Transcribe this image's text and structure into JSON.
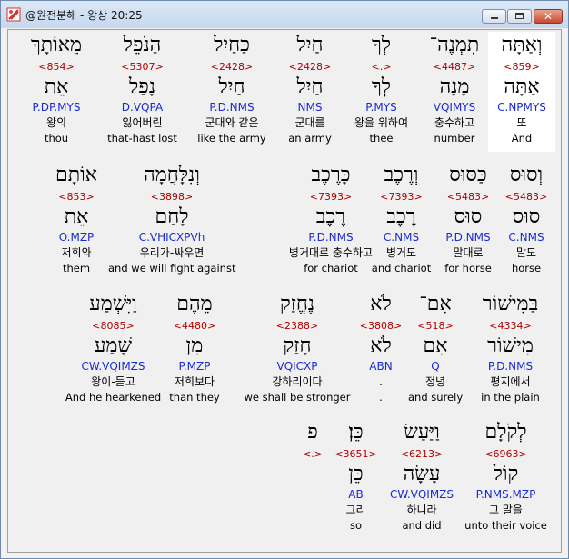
{
  "window": {
    "title": "@원전분해 - 왕상 20:25"
  },
  "verse": [
    {
      "id": "c1",
      "surface": "מֵאוֹתָךְ",
      "strongs": "<854>",
      "lemma": "אֵת",
      "parse": "P.DP.MYS",
      "korean": "왕의",
      "english": "thou"
    },
    {
      "id": "c2",
      "surface": "הַנֹּפֵל",
      "strongs": "<5307>",
      "lemma": "נָפַל",
      "parse": "D.VQPA",
      "korean": "잃어버린",
      "english": "that-hast lost"
    },
    {
      "id": "c3",
      "surface": "כַּחַיִל",
      "strongs": "<2428>",
      "lemma": "חַיִל",
      "parse": "P.D.NMS",
      "korean": "군대와 같은",
      "english": "like the army"
    },
    {
      "id": "c4",
      "surface": "חַיִל",
      "strongs": "<2428>",
      "lemma": "חַיִל",
      "parse": "NMS",
      "korean": "군대를",
      "english": "an army"
    },
    {
      "id": "c5",
      "surface": "לְךָ",
      "strongs": "<.>",
      "lemma": "לְךָ",
      "parse": "P.MYS",
      "korean": "왕을 위하여",
      "english": "thee"
    },
    {
      "id": "c6",
      "surface": "תִמְנֶה־",
      "strongs": "<4487>",
      "lemma": "מָנָה",
      "parse": "VQIMYS",
      "korean": "충수하고",
      "english": "number"
    },
    {
      "id": "c7",
      "surface": "וְאַתָּה",
      "strongs": "<859>",
      "lemma": "אַתָּה",
      "parse": "C.NPMYS",
      "korean": "또",
      "english": "And"
    },
    {
      "id": "c8",
      "surface": "אוֹתָם",
      "strongs": "<853>",
      "lemma": "אֵת",
      "parse": "O.MZP",
      "korean": "저희와",
      "english": "them"
    },
    {
      "id": "c9",
      "surface": "וְנִלָּחֲמָה",
      "strongs": "<3898>",
      "lemma": "לָחַם",
      "parse": "C.VHICXPVh",
      "korean": "우리가-싸우면",
      "english": "and we will fight against"
    },
    {
      "id": "c10",
      "surface": "כָּרֶכֶב",
      "strongs": "<7393>",
      "lemma": "רֶכֶב",
      "parse": "P.D.NMS",
      "korean": "병거대로 충수하고",
      "english": "for chariot"
    },
    {
      "id": "c11",
      "surface": "וְרֶכֶב",
      "strongs": "<7393>",
      "lemma": "רֶכֶב",
      "parse": "C.NMS",
      "korean": "병거도",
      "english": "and chariot"
    },
    {
      "id": "c12",
      "surface": "כַּסּוּס",
      "strongs": "<5483>",
      "lemma": "סוּס",
      "parse": "P.D.NMS",
      "korean": "말대로",
      "english": "for horse"
    },
    {
      "id": "c13",
      "surface": "וְסוּס",
      "strongs": "<5483>",
      "lemma": "סוּס",
      "parse": "C.NMS",
      "korean": "말도",
      "english": "horse"
    },
    {
      "id": "c14",
      "surface": "וַיִּשְׁמַע",
      "strongs": "<8085>",
      "lemma": "שָׁמַע",
      "parse": "CW.VQIMZS",
      "korean": "왕이-듣고",
      "english": "And he hearkened"
    },
    {
      "id": "c15",
      "surface": "מֵהֶם",
      "strongs": "<4480>",
      "lemma": "מִן",
      "parse": "P.MZP",
      "korean": "저희보다",
      "english": "than they"
    },
    {
      "id": "c16",
      "surface": "נֶחֱזַק",
      "strongs": "<2388>",
      "lemma": "חָזַק",
      "parse": "VQICXP",
      "korean": "강하리이다",
      "english": "we shall be stronger"
    },
    {
      "id": "c17",
      "surface": "לֹא",
      "strongs": "<3808>",
      "lemma": "לֹא",
      "parse": "ABN",
      "korean": ".",
      "english": "."
    },
    {
      "id": "c18",
      "surface": "אִם־",
      "strongs": "<518>",
      "lemma": "אִם",
      "parse": "Q",
      "korean": "정녕",
      "english": "and surely"
    },
    {
      "id": "c19",
      "surface": "בַּמִּישׁוֹר",
      "strongs": "<4334>",
      "lemma": "מִישׁוֹר",
      "parse": "P.D.NMS",
      "korean": "평지에서",
      "english": "in the plain"
    },
    {
      "id": "c20",
      "surface": "פ",
      "strongs": "<.>",
      "lemma": "",
      "parse": "",
      "korean": "",
      "english": ""
    },
    {
      "id": "c21",
      "surface": "כֵּן׃",
      "strongs": "<3651>",
      "lemma": "כֵּן",
      "parse": "AB",
      "korean": "그리",
      "english": "so"
    },
    {
      "id": "c22",
      "surface": "וַיַּעַשׂ",
      "strongs": "<6213>",
      "lemma": "עָשָׂה",
      "parse": "CW.VQIMZS",
      "korean": "하니라",
      "english": "and did"
    },
    {
      "id": "c23",
      "surface": "לְקֹלָם",
      "strongs": "<6963>",
      "lemma": "קוֹל",
      "parse": "P.NMS.MZP",
      "korean": "그 말을",
      "english": "unto their voice"
    }
  ]
}
